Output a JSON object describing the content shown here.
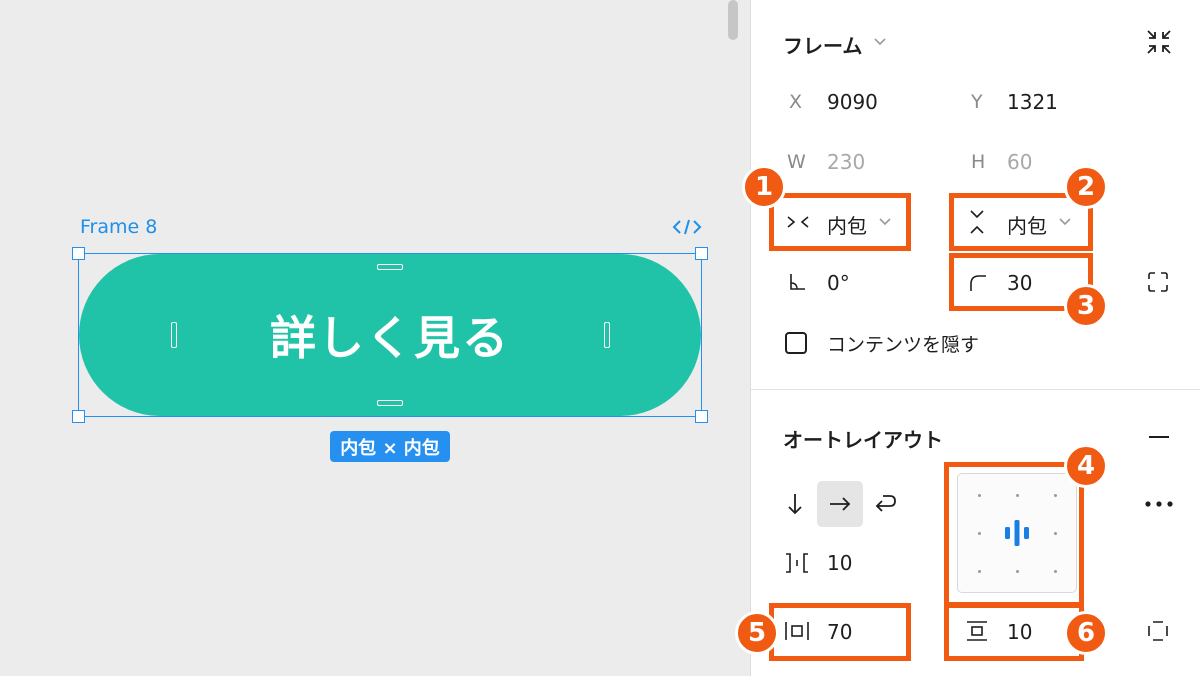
{
  "canvas": {
    "frame_label": "Frame 8",
    "button_text": "詳しく見る",
    "size_badge": "内包 × 内包",
    "button_color": "#20c2a8",
    "selection_color": "#2590f0"
  },
  "frame_section": {
    "title": "フレーム",
    "x_label": "X",
    "x_value": "9090",
    "y_label": "Y",
    "y_value": "1321",
    "w_label": "W",
    "w_value": "230",
    "h_label": "H",
    "h_value": "60",
    "width_sizing": "内包",
    "height_sizing": "内包",
    "rotation_value": "0°",
    "corner_radius_value": "30",
    "clip_content_label": "コンテンツを隠す",
    "clip_content_checked": false
  },
  "auto_layout": {
    "title": "オートレイアウト",
    "directions": [
      "down-arrow-icon",
      "right-arrow-icon",
      "wrap-icon"
    ],
    "active_direction": "horizontal",
    "gap_value": "10",
    "horizontal_padding_value": "70",
    "vertical_padding_value": "10",
    "alignment": "center"
  },
  "annotations": [
    "1",
    "2",
    "3",
    "4",
    "5",
    "6"
  ],
  "accent_color": "#f15a13"
}
